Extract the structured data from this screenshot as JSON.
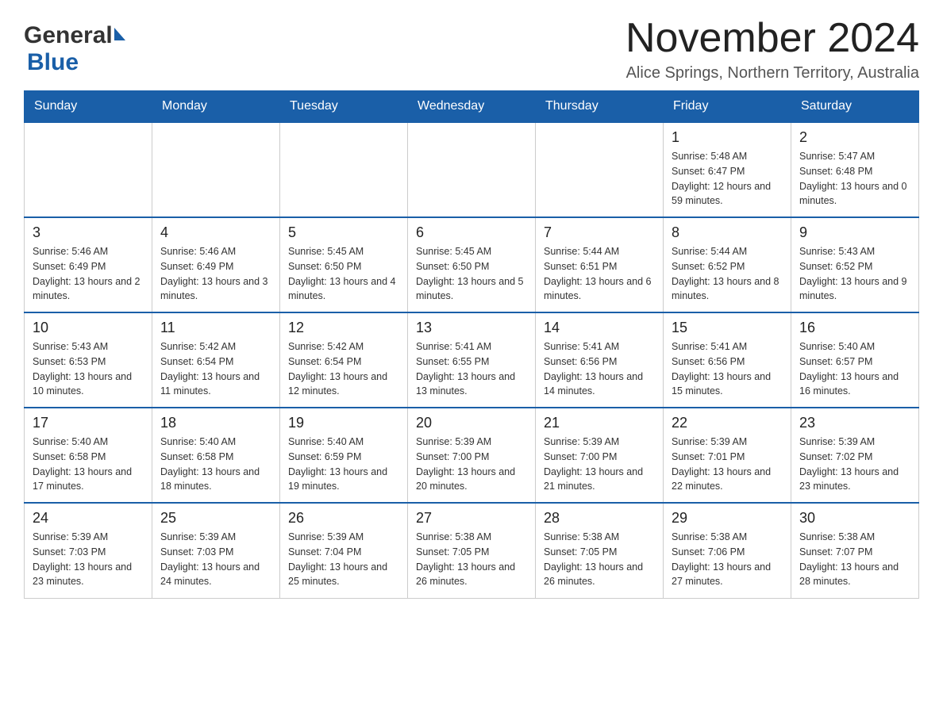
{
  "header": {
    "logo_general": "General",
    "logo_blue": "Blue",
    "month_title": "November 2024",
    "location": "Alice Springs, Northern Territory, Australia"
  },
  "days_of_week": [
    "Sunday",
    "Monday",
    "Tuesday",
    "Wednesday",
    "Thursday",
    "Friday",
    "Saturday"
  ],
  "weeks": [
    [
      {
        "day": "",
        "sunrise": "",
        "sunset": "",
        "daylight": ""
      },
      {
        "day": "",
        "sunrise": "",
        "sunset": "",
        "daylight": ""
      },
      {
        "day": "",
        "sunrise": "",
        "sunset": "",
        "daylight": ""
      },
      {
        "day": "",
        "sunrise": "",
        "sunset": "",
        "daylight": ""
      },
      {
        "day": "",
        "sunrise": "",
        "sunset": "",
        "daylight": ""
      },
      {
        "day": "1",
        "sunrise": "Sunrise: 5:48 AM",
        "sunset": "Sunset: 6:47 PM",
        "daylight": "Daylight: 12 hours and 59 minutes."
      },
      {
        "day": "2",
        "sunrise": "Sunrise: 5:47 AM",
        "sunset": "Sunset: 6:48 PM",
        "daylight": "Daylight: 13 hours and 0 minutes."
      }
    ],
    [
      {
        "day": "3",
        "sunrise": "Sunrise: 5:46 AM",
        "sunset": "Sunset: 6:49 PM",
        "daylight": "Daylight: 13 hours and 2 minutes."
      },
      {
        "day": "4",
        "sunrise": "Sunrise: 5:46 AM",
        "sunset": "Sunset: 6:49 PM",
        "daylight": "Daylight: 13 hours and 3 minutes."
      },
      {
        "day": "5",
        "sunrise": "Sunrise: 5:45 AM",
        "sunset": "Sunset: 6:50 PM",
        "daylight": "Daylight: 13 hours and 4 minutes."
      },
      {
        "day": "6",
        "sunrise": "Sunrise: 5:45 AM",
        "sunset": "Sunset: 6:50 PM",
        "daylight": "Daylight: 13 hours and 5 minutes."
      },
      {
        "day": "7",
        "sunrise": "Sunrise: 5:44 AM",
        "sunset": "Sunset: 6:51 PM",
        "daylight": "Daylight: 13 hours and 6 minutes."
      },
      {
        "day": "8",
        "sunrise": "Sunrise: 5:44 AM",
        "sunset": "Sunset: 6:52 PM",
        "daylight": "Daylight: 13 hours and 8 minutes."
      },
      {
        "day": "9",
        "sunrise": "Sunrise: 5:43 AM",
        "sunset": "Sunset: 6:52 PM",
        "daylight": "Daylight: 13 hours and 9 minutes."
      }
    ],
    [
      {
        "day": "10",
        "sunrise": "Sunrise: 5:43 AM",
        "sunset": "Sunset: 6:53 PM",
        "daylight": "Daylight: 13 hours and 10 minutes."
      },
      {
        "day": "11",
        "sunrise": "Sunrise: 5:42 AM",
        "sunset": "Sunset: 6:54 PM",
        "daylight": "Daylight: 13 hours and 11 minutes."
      },
      {
        "day": "12",
        "sunrise": "Sunrise: 5:42 AM",
        "sunset": "Sunset: 6:54 PM",
        "daylight": "Daylight: 13 hours and 12 minutes."
      },
      {
        "day": "13",
        "sunrise": "Sunrise: 5:41 AM",
        "sunset": "Sunset: 6:55 PM",
        "daylight": "Daylight: 13 hours and 13 minutes."
      },
      {
        "day": "14",
        "sunrise": "Sunrise: 5:41 AM",
        "sunset": "Sunset: 6:56 PM",
        "daylight": "Daylight: 13 hours and 14 minutes."
      },
      {
        "day": "15",
        "sunrise": "Sunrise: 5:41 AM",
        "sunset": "Sunset: 6:56 PM",
        "daylight": "Daylight: 13 hours and 15 minutes."
      },
      {
        "day": "16",
        "sunrise": "Sunrise: 5:40 AM",
        "sunset": "Sunset: 6:57 PM",
        "daylight": "Daylight: 13 hours and 16 minutes."
      }
    ],
    [
      {
        "day": "17",
        "sunrise": "Sunrise: 5:40 AM",
        "sunset": "Sunset: 6:58 PM",
        "daylight": "Daylight: 13 hours and 17 minutes."
      },
      {
        "day": "18",
        "sunrise": "Sunrise: 5:40 AM",
        "sunset": "Sunset: 6:58 PM",
        "daylight": "Daylight: 13 hours and 18 minutes."
      },
      {
        "day": "19",
        "sunrise": "Sunrise: 5:40 AM",
        "sunset": "Sunset: 6:59 PM",
        "daylight": "Daylight: 13 hours and 19 minutes."
      },
      {
        "day": "20",
        "sunrise": "Sunrise: 5:39 AM",
        "sunset": "Sunset: 7:00 PM",
        "daylight": "Daylight: 13 hours and 20 minutes."
      },
      {
        "day": "21",
        "sunrise": "Sunrise: 5:39 AM",
        "sunset": "Sunset: 7:00 PM",
        "daylight": "Daylight: 13 hours and 21 minutes."
      },
      {
        "day": "22",
        "sunrise": "Sunrise: 5:39 AM",
        "sunset": "Sunset: 7:01 PM",
        "daylight": "Daylight: 13 hours and 22 minutes."
      },
      {
        "day": "23",
        "sunrise": "Sunrise: 5:39 AM",
        "sunset": "Sunset: 7:02 PM",
        "daylight": "Daylight: 13 hours and 23 minutes."
      }
    ],
    [
      {
        "day": "24",
        "sunrise": "Sunrise: 5:39 AM",
        "sunset": "Sunset: 7:03 PM",
        "daylight": "Daylight: 13 hours and 23 minutes."
      },
      {
        "day": "25",
        "sunrise": "Sunrise: 5:39 AM",
        "sunset": "Sunset: 7:03 PM",
        "daylight": "Daylight: 13 hours and 24 minutes."
      },
      {
        "day": "26",
        "sunrise": "Sunrise: 5:39 AM",
        "sunset": "Sunset: 7:04 PM",
        "daylight": "Daylight: 13 hours and 25 minutes."
      },
      {
        "day": "27",
        "sunrise": "Sunrise: 5:38 AM",
        "sunset": "Sunset: 7:05 PM",
        "daylight": "Daylight: 13 hours and 26 minutes."
      },
      {
        "day": "28",
        "sunrise": "Sunrise: 5:38 AM",
        "sunset": "Sunset: 7:05 PM",
        "daylight": "Daylight: 13 hours and 26 minutes."
      },
      {
        "day": "29",
        "sunrise": "Sunrise: 5:38 AM",
        "sunset": "Sunset: 7:06 PM",
        "daylight": "Daylight: 13 hours and 27 minutes."
      },
      {
        "day": "30",
        "sunrise": "Sunrise: 5:38 AM",
        "sunset": "Sunset: 7:07 PM",
        "daylight": "Daylight: 13 hours and 28 minutes."
      }
    ]
  ]
}
